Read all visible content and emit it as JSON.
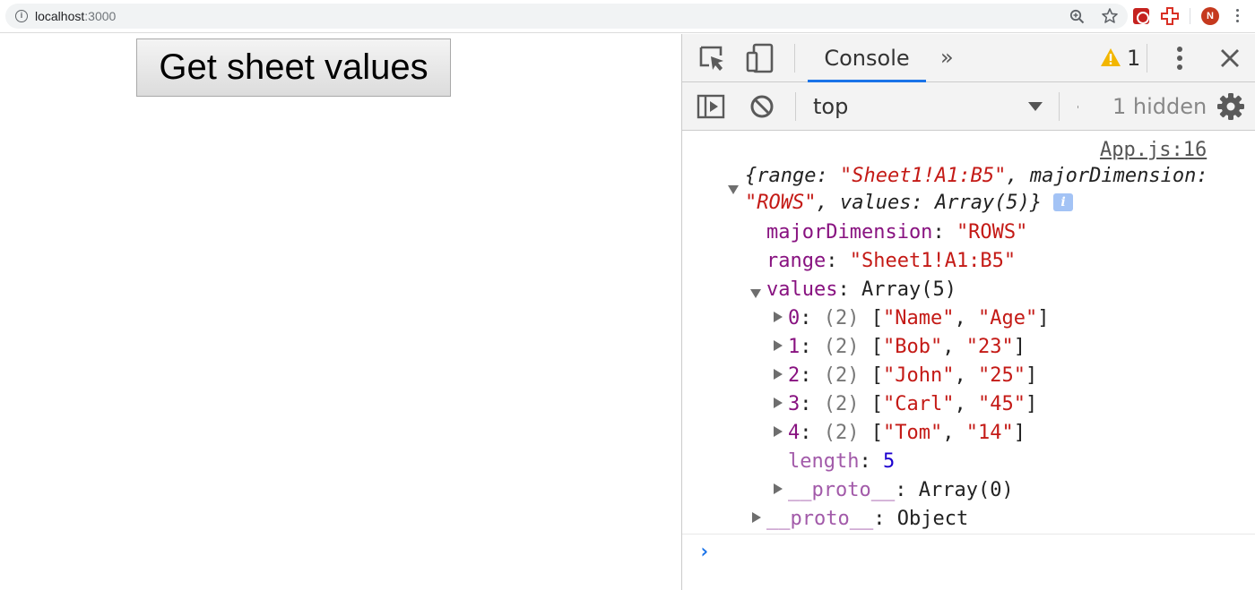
{
  "browser": {
    "url_host": "localhost",
    "url_port": ":3000",
    "profile_initial": "N"
  },
  "page": {
    "button_label": "Get sheet values"
  },
  "devtools": {
    "tab_label": "Console",
    "more_tabs": "»",
    "warning_count": "1",
    "context": "top",
    "hidden_label": "1 hidden",
    "accent_color": "#1a73e8"
  },
  "console": {
    "source": "App.js:16",
    "summary": {
      "open": "{",
      "range_key": "range: ",
      "range_val": "\"Sheet1!A1:B5\"",
      "sep1": ", ",
      "major_key": "majorDimension:",
      "major_val": "\"ROWS\"",
      "sep2": ", ",
      "values_key": "values: ",
      "values_val": "Array(5)",
      "close": "}"
    },
    "majorDimension": {
      "key": "majorDimension",
      "colon": ": ",
      "value": "\"ROWS\""
    },
    "range": {
      "key": "range",
      "colon": ": ",
      "value": "\"Sheet1!A1:B5\""
    },
    "values": {
      "key": "values",
      "colon": ": ",
      "value": "Array(5)"
    },
    "rows": [
      {
        "index": "0",
        "colon": ": ",
        "count": "(2) ",
        "open": "[",
        "a": "\"Name\"",
        "comma": ", ",
        "b": "\"Age\"",
        "close": "]"
      },
      {
        "index": "1",
        "colon": ": ",
        "count": "(2) ",
        "open": "[",
        "a": "\"Bob\"",
        "comma": ", ",
        "b": "\"23\"",
        "close": "]"
      },
      {
        "index": "2",
        "colon": ": ",
        "count": "(2) ",
        "open": "[",
        "a": "\"John\"",
        "comma": ", ",
        "b": "\"25\"",
        "close": "]"
      },
      {
        "index": "3",
        "colon": ": ",
        "count": "(2) ",
        "open": "[",
        "a": "\"Carl\"",
        "comma": ", ",
        "b": "\"45\"",
        "close": "]"
      },
      {
        "index": "4",
        "colon": ": ",
        "count": "(2) ",
        "open": "[",
        "a": "\"Tom\"",
        "comma": ", ",
        "b": "\"14\"",
        "close": "]"
      }
    ],
    "length": {
      "key": "length",
      "colon": ": ",
      "value": "5"
    },
    "array_proto": {
      "key": "__proto__",
      "colon": ": ",
      "value": "Array(0)"
    },
    "object_proto": {
      "key": "__proto__",
      "colon": ": ",
      "value": "Object"
    },
    "prompt": "›"
  }
}
